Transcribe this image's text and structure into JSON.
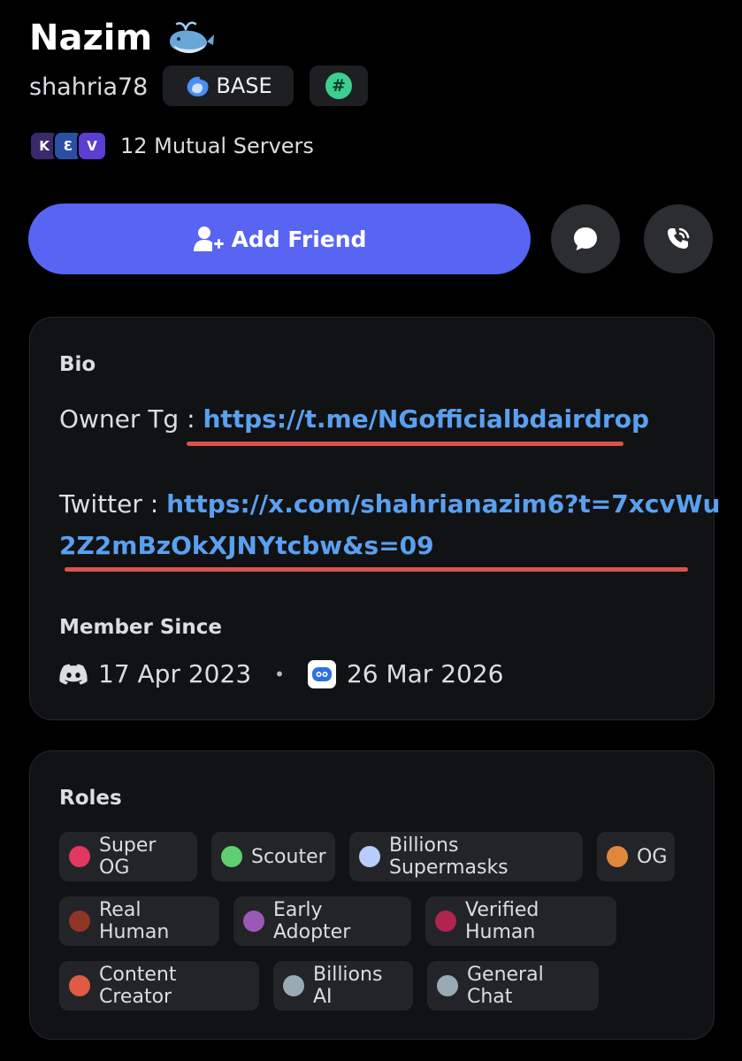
{
  "profile": {
    "display_name": "Nazim",
    "username": "shahria78",
    "badge_label": "BASE",
    "hash_symbol": "#",
    "mutual_servers": "12 Mutual Servers",
    "server_icons": [
      "K",
      "Ɛ",
      "V"
    ]
  },
  "actions": {
    "add_friend": "Add Friend"
  },
  "bio": {
    "title": "Bio",
    "owner_label": "Owner Tg : ",
    "owner_link": "https://t.me/NGofficialbdairdrop",
    "twitter_label": "Twitter : ",
    "twitter_link_part1": "https://x.com/shahrianazim6?t=7xcvWu",
    "twitter_link_part2": "2Z2mBzOkXJNYtcbw&s=09"
  },
  "member_since": {
    "title": "Member Since",
    "discord_date": "17 Apr 2023",
    "separator": "•",
    "server_date": "26 Mar 2026"
  },
  "roles": {
    "title": "Roles",
    "items": [
      {
        "label": "Super OG",
        "color": "#e0385f"
      },
      {
        "label": "Scouter",
        "color": "#5ecf72"
      },
      {
        "label": "Billions Supermasks",
        "color": "#b8cdfb"
      },
      {
        "label": "OG",
        "color": "#e0873b"
      },
      {
        "label": "Real Human",
        "color": "#8f3526"
      },
      {
        "label": "Early Adopter",
        "color": "#9b59b6"
      },
      {
        "label": "Verified Human",
        "color": "#b0244f"
      },
      {
        "label": "Content Creator",
        "color": "#e05a45"
      },
      {
        "label": "Billions AI",
        "color": "#99aab5"
      },
      {
        "label": "General Chat",
        "color": "#99aab5"
      }
    ]
  },
  "colors": {
    "accent": "#5865f2",
    "link": "#5aa0f0",
    "underline": "#d9534f",
    "background": "#000000",
    "card": "#111214"
  },
  "icons": {
    "name_emoji": "whale-icon",
    "add_friend": "add-friend-icon",
    "message": "chat-bubble-icon",
    "call": "phone-call-icon",
    "discord": "discord-icon",
    "server": "server-app-icon"
  }
}
